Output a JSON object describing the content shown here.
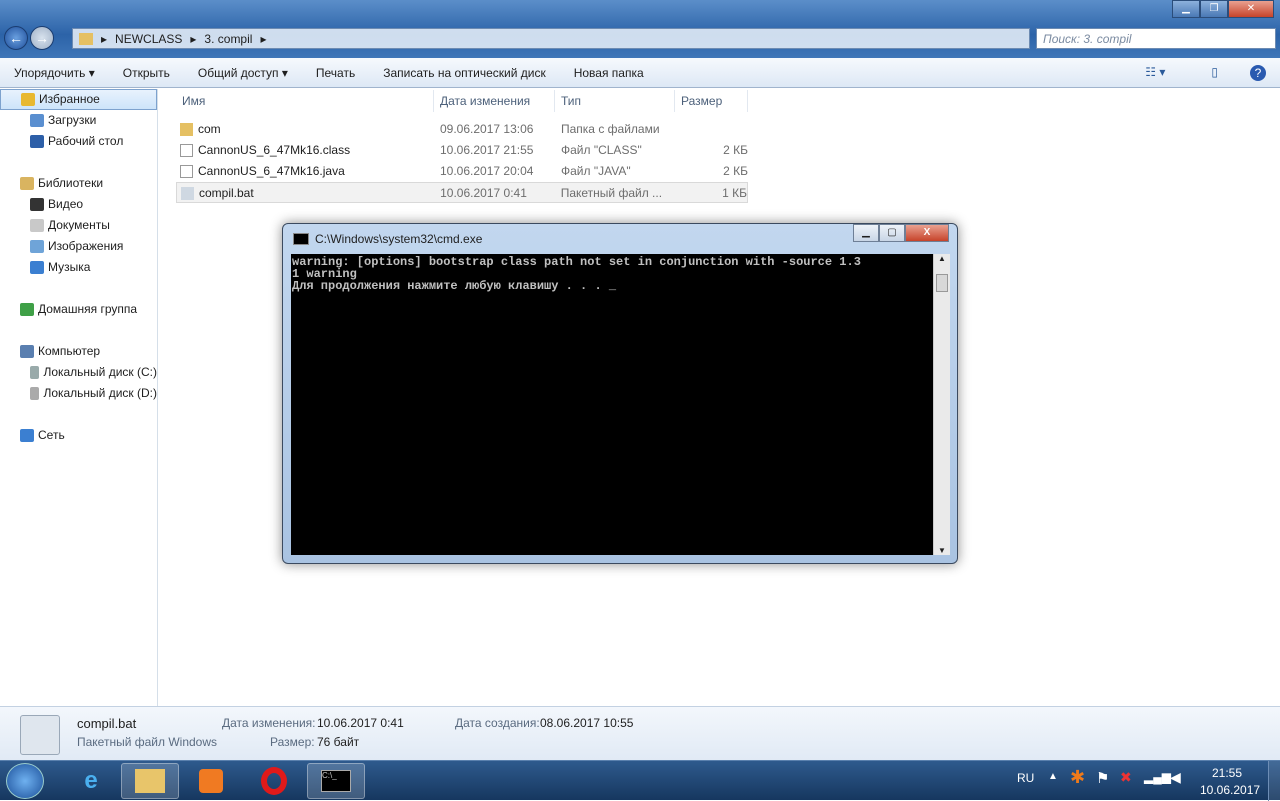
{
  "explorer": {
    "breadcrumb": [
      "NEWCLASS",
      "3. compil"
    ],
    "search_placeholder": "Поиск: 3. compil",
    "toolbar": [
      "Упорядочить ▾",
      "Открыть",
      "Общий доступ ▾",
      "Печать",
      "Записать на оптический диск",
      "Новая папка"
    ],
    "nav": [
      {
        "label": "Избранное",
        "indent": 0,
        "icon": "star-icon",
        "color": "#e8b830",
        "sel": true
      },
      {
        "label": "Загрузки",
        "indent": 1,
        "icon": "downloads-icon",
        "color": "#5a8fd0"
      },
      {
        "label": "Рабочий стол",
        "indent": 1,
        "icon": "desktop-icon",
        "color": "#2d5fa8"
      },
      {
        "label": "",
        "indent": 0
      },
      {
        "label": "Библиотеки",
        "indent": 0,
        "icon": "libraries-icon",
        "color": "#d9b460"
      },
      {
        "label": "Видео",
        "indent": 1,
        "icon": "video-icon",
        "color": "#333"
      },
      {
        "label": "Документы",
        "indent": 1,
        "icon": "documents-icon",
        "color": "#c9c9c9"
      },
      {
        "label": "Изображения",
        "indent": 1,
        "icon": "pictures-icon",
        "color": "#6fa4d8"
      },
      {
        "label": "Музыка",
        "indent": 1,
        "icon": "music-icon",
        "color": "#3b7fd1"
      },
      {
        "label": "",
        "indent": 0
      },
      {
        "label": "Домашняя группа",
        "indent": 0,
        "icon": "homegroup-icon",
        "color": "#3fa047"
      },
      {
        "label": "",
        "indent": 0
      },
      {
        "label": "Компьютер",
        "indent": 0,
        "icon": "computer-icon",
        "color": "#5a7fb0"
      },
      {
        "label": "Локальный диск (C:)",
        "indent": 1,
        "icon": "drive-c-icon",
        "color": "#9aa"
      },
      {
        "label": "Локальный диск (D:)",
        "indent": 1,
        "icon": "drive-d-icon",
        "color": "#aaa"
      },
      {
        "label": "",
        "indent": 0
      },
      {
        "label": "Сеть",
        "indent": 0,
        "icon": "network-icon",
        "color": "#3b7fd1"
      }
    ],
    "columns": [
      "Имя",
      "Дата изменения",
      "Тип",
      "Размер"
    ],
    "files": [
      {
        "name": "com",
        "date": "09.06.2017 13:06",
        "type": "Папка с файлами",
        "size": "",
        "icon": "folder-icon"
      },
      {
        "name": "CannonUS_6_47Mk16.class",
        "date": "10.06.2017 21:55",
        "type": "Файл \"CLASS\"",
        "size": "2 КБ",
        "icon": "file-icon"
      },
      {
        "name": "CannonUS_6_47Mk16.java",
        "date": "10.06.2017 20:04",
        "type": "Файл \"JAVA\"",
        "size": "2 КБ",
        "icon": "file-icon"
      },
      {
        "name": "compil.bat",
        "date": "10.06.2017 0:41",
        "type": "Пакетный файл ...",
        "size": "1 КБ",
        "icon": "batch-file-icon"
      }
    ],
    "details": {
      "name": "compil.bat",
      "type": "Пакетный файл Windows",
      "modified_label": "Дата изменения:",
      "modified": "10.06.2017 0:41",
      "created_label": "Дата создания:",
      "created": "08.06.2017 10:55",
      "size_label": "Размер:",
      "size": "76 байт"
    }
  },
  "cmd": {
    "title": "C:\\Windows\\system32\\cmd.exe",
    "lines": [
      "warning: [options] bootstrap class path not set in conjunction with -source 1.3",
      "1 warning",
      "Для продолжения нажмите любую клавишу . . . _"
    ]
  },
  "taskbar": {
    "lang": "RU",
    "time": "21:55",
    "date": "10.06.2017"
  }
}
